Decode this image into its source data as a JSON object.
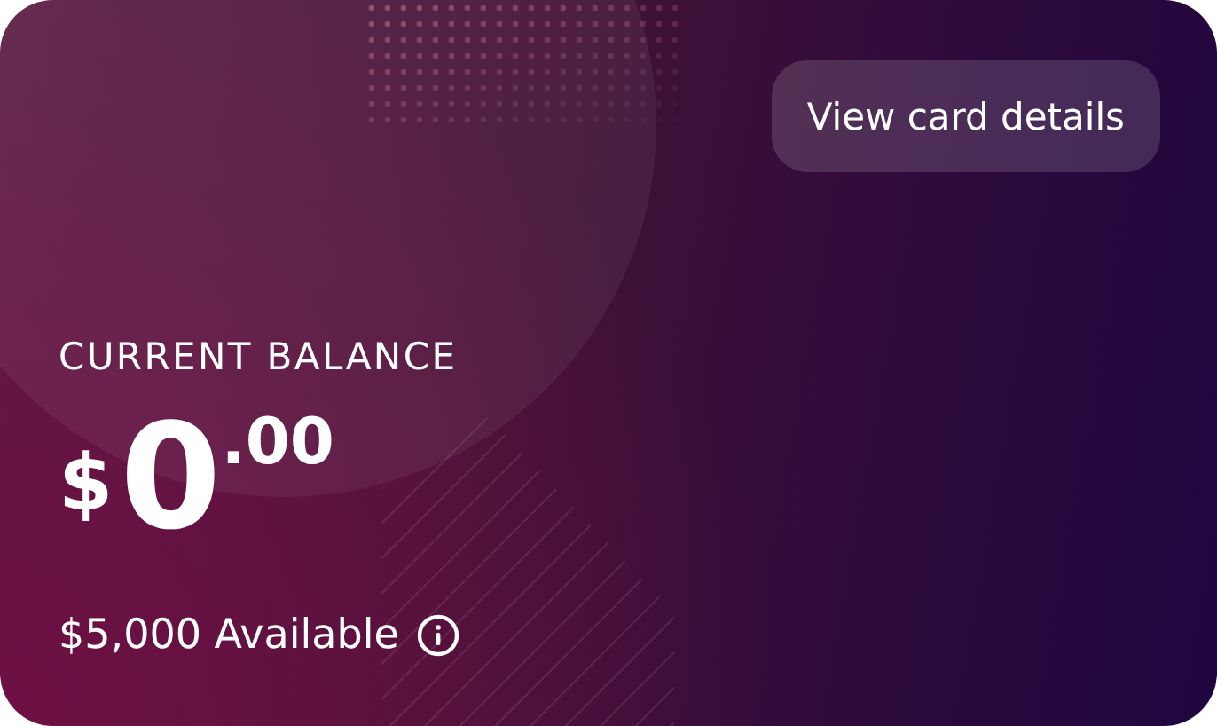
{
  "card": {
    "action_button": "View card details",
    "balance_label": "CURRENT BALANCE",
    "balance": {
      "currency": "$",
      "whole": "0",
      "cents": ".00"
    },
    "available": "$5,000 Available"
  }
}
